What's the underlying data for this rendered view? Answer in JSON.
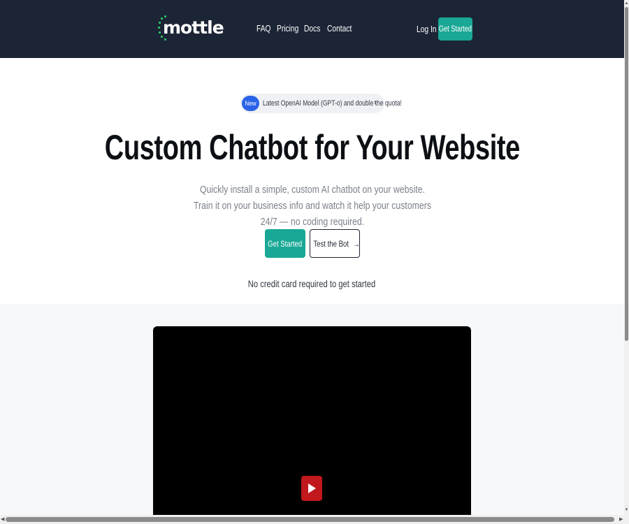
{
  "header": {
    "logo_text": "mottle",
    "nav": [
      "FAQ",
      "Pricing",
      "Docs",
      "Contact"
    ],
    "login_label": "Log In",
    "cta_label": "Get Started"
  },
  "announcement": {
    "badge": "New",
    "text": "Latest OpenAI Model (GPT-o) and double the quota!",
    "chevron": "›"
  },
  "hero": {
    "title": "Custom Chatbot for Your Website",
    "subtitle": "Quickly install a simple, custom AI chatbot on your website. Train it on your business info and watch it help your customers 24/7 — no coding required.",
    "primary_label": "Get Started",
    "secondary_label": "Test the Bot",
    "secondary_arrow": "→",
    "note": "No credit card required to get started"
  },
  "video": {
    "play_icon": "play-icon"
  },
  "colors": {
    "header_bg": "#1c2536",
    "accent": "#19a896",
    "badge": "#2b63e8",
    "play": "#c0181c",
    "logo_dots": "#2fd46b"
  }
}
